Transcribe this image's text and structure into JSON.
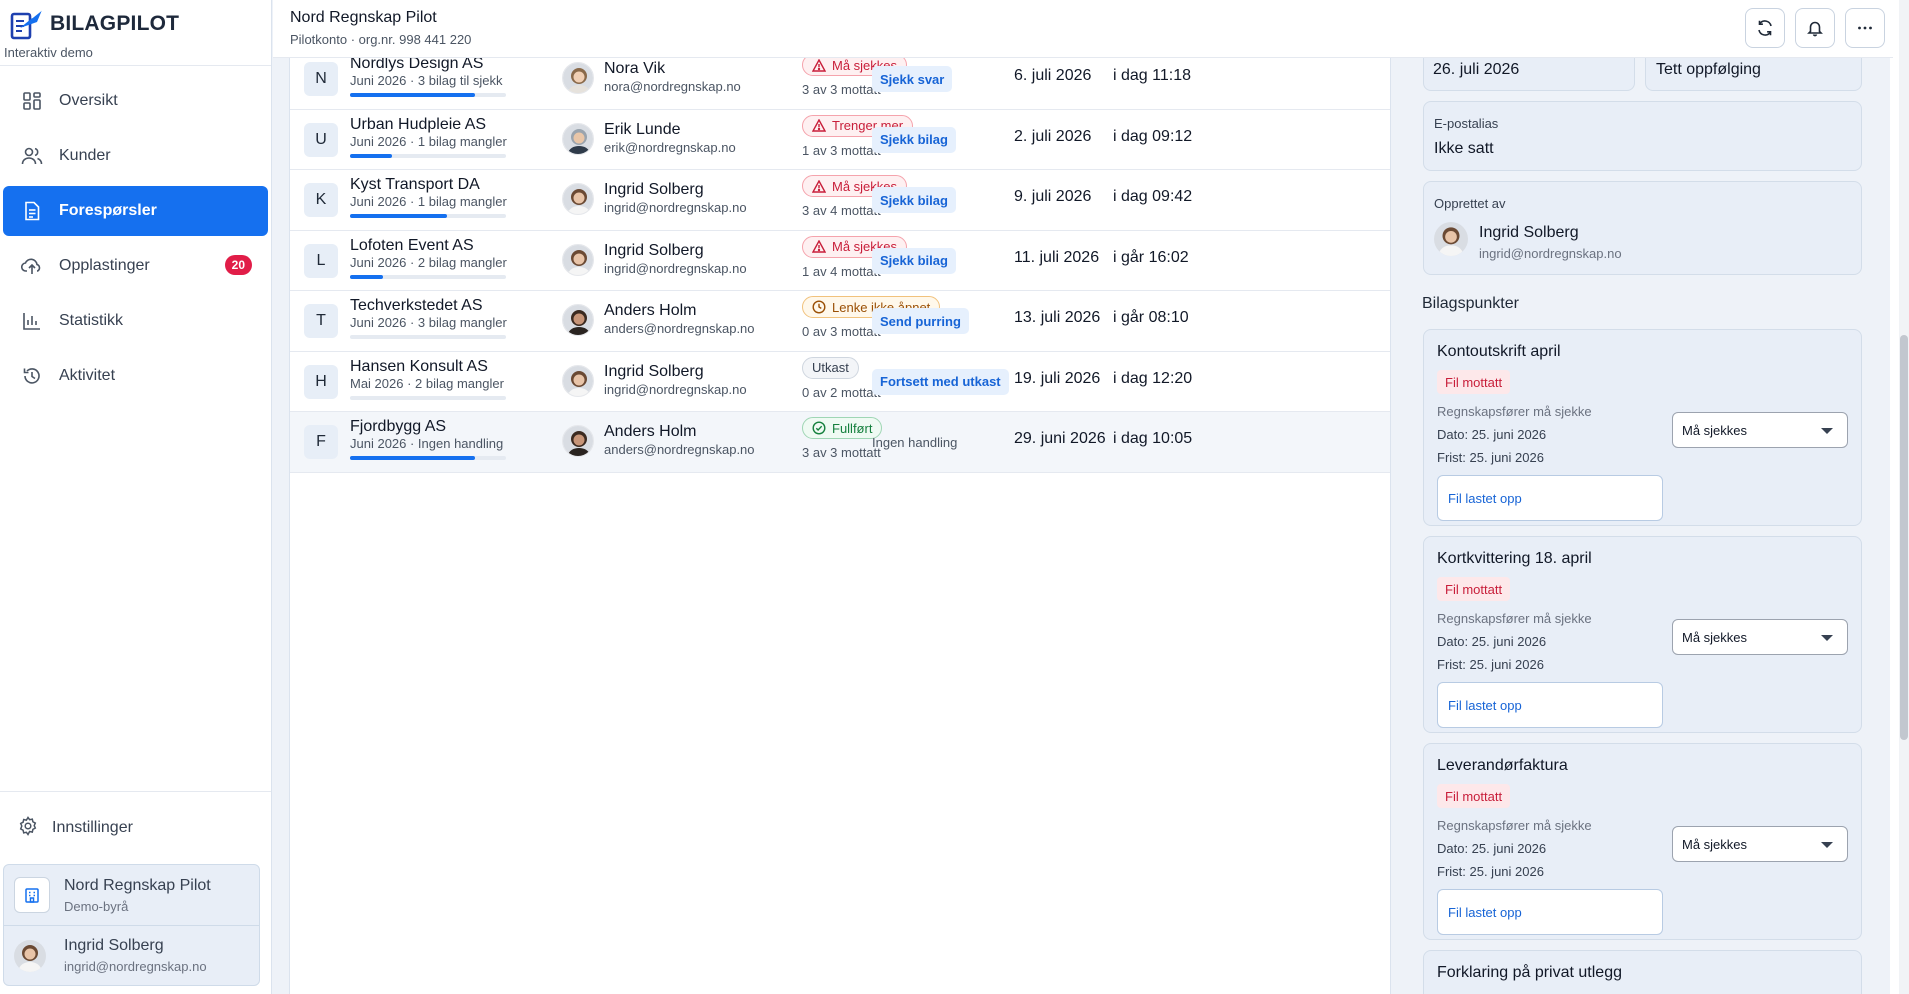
{
  "brand": {
    "name": "BILAGPILOT",
    "subtitle": "Interaktiv demo"
  },
  "nav": [
    {
      "label": "Oversikt",
      "icon": "grid-icon"
    },
    {
      "label": "Kunder",
      "icon": "users-icon"
    },
    {
      "label": "Forespørsler",
      "icon": "document-icon",
      "active": true
    },
    {
      "label": "Opplastinger",
      "icon": "upload-icon",
      "badge": "20"
    },
    {
      "label": "Statistikk",
      "icon": "bar-chart-icon"
    },
    {
      "label": "Aktivitet",
      "icon": "history-icon"
    }
  ],
  "settings_label": "Innstillinger",
  "account": {
    "org_name": "Nord Regnskap Pilot",
    "org_sub": "Demo-byrå",
    "user_name": "Ingrid Solberg",
    "user_email": "ingrid@nordregnskap.no"
  },
  "topbar": {
    "title": "Nord Regnskap Pilot",
    "subtitle": "Pilotkonto · org.nr. 998 441 220",
    "buttons": [
      "refresh-icon",
      "bell-icon",
      "more-icon"
    ]
  },
  "colors": {
    "accent": "#1570ef",
    "danger": "#c81e3a",
    "warning": "#9a4f05",
    "success": "#15803d",
    "badge": "#e11d48"
  },
  "rows": [
    {
      "initial": "N",
      "company": "Nordlys Design AS",
      "meta": "Juni 2026 · 3 bilag til sjekk",
      "progress": 0.8,
      "person": "Nora Vik",
      "email": "nora@nordregnskap.no",
      "status": "Må sjekkes",
      "status_kind": "red",
      "status_icon": "warning-icon",
      "received": "3 av 3 mottatt",
      "action": "Sjekk svar",
      "due": "6. juli 2026",
      "updated": "i dag 11:18"
    },
    {
      "initial": "U",
      "company": "Urban Hudpleie AS",
      "meta": "Juni 2026 · 1 bilag mangler",
      "progress": 0.27,
      "person": "Erik Lunde",
      "email": "erik@nordregnskap.no",
      "status": "Trenger mer",
      "status_kind": "red",
      "status_icon": "warning-icon",
      "received": "1 av 3 mottatt",
      "action": "Sjekk bilag",
      "due": "2. juli 2026",
      "updated": "i dag 09:12"
    },
    {
      "initial": "K",
      "company": "Kyst Transport DA",
      "meta": "Juni 2026 · 1 bilag mangler",
      "progress": 0.62,
      "person": "Ingrid Solberg",
      "email": "ingrid@nordregnskap.no",
      "status": "Må sjekkes",
      "status_kind": "red",
      "status_icon": "warning-icon",
      "received": "3 av 4 mottatt",
      "action": "Sjekk bilag",
      "due": "9. juli 2026",
      "updated": "i dag 09:42"
    },
    {
      "initial": "L",
      "company": "Lofoten Event AS",
      "meta": "Juni 2026 · 2 bilag mangler",
      "progress": 0.21,
      "person": "Ingrid Solberg",
      "email": "ingrid@nordregnskap.no",
      "status": "Må sjekkes",
      "status_kind": "red",
      "status_icon": "warning-icon",
      "received": "1 av 4 mottatt",
      "action": "Sjekk bilag",
      "due": "11. juli 2026",
      "updated": "i går 16:02"
    },
    {
      "initial": "T",
      "company": "Techverkstedet AS",
      "meta": "Juni 2026 · 3 bilag mangler",
      "progress": 0,
      "person": "Anders Holm",
      "email": "anders@nordregnskap.no",
      "status": "Lenke ikke åpnet",
      "status_kind": "amber",
      "status_icon": "clock-icon",
      "received": "0 av 3 mottatt",
      "action": "Send purring",
      "due": "13. juli 2026",
      "updated": "i går 08:10"
    },
    {
      "initial": "H",
      "company": "Hansen Konsult AS",
      "meta": "Mai 2026 · 2 bilag mangler",
      "progress": 0,
      "person": "Ingrid Solberg",
      "email": "ingrid@nordregnskap.no",
      "status": "Utkast",
      "status_kind": "grey",
      "status_icon": "",
      "received": "0 av 2 mottatt",
      "action": "Fortsett med utkast",
      "due": "19. juli 2026",
      "updated": "i dag 12:20"
    },
    {
      "initial": "F",
      "company": "Fjordbygg AS",
      "meta": "Juni 2026 · Ingen handling",
      "progress": 0.8,
      "person": "Anders Holm",
      "email": "anders@nordregnskap.no",
      "status": "Fullført",
      "status_kind": "green",
      "status_icon": "check-circle-icon",
      "received": "3 av 3 mottatt",
      "action": "Ingen handling",
      "action_plain": true,
      "due": "29. juni 2026",
      "updated": "i dag 10:05"
    }
  ],
  "details": {
    "deadline_value": "26. juli 2026",
    "follow_up_value": "Tett oppfølging",
    "email_alias_label": "E-postalias",
    "email_alias_value": "Ikke satt",
    "created_by_label": "Opprettet av",
    "created_by_name": "Ingrid Solberg",
    "created_by_email": "ingrid@nordregnskap.no",
    "points_heading": "Bilagspunkter"
  },
  "points": [
    {
      "title": "Kontoutskrift april",
      "badge": "Fil mottatt",
      "note": "Regnskapsfører må sjekke",
      "date": "Dato: 25. juni 2026",
      "deadline": "Frist: 25. juni 2026",
      "select": "Må sjekkes",
      "file": "Fil lastet opp"
    },
    {
      "title": "Kortkvittering 18. april",
      "badge": "Fil mottatt",
      "note": "Regnskapsfører må sjekke",
      "date": "Dato: 25. juni 2026",
      "deadline": "Frist: 25. juni 2026",
      "select": "Må sjekkes",
      "file": "Fil lastet opp"
    },
    {
      "title": "Leverandørfaktura",
      "badge": "Fil mottatt",
      "note": "Regnskapsfører må sjekke",
      "date": "Dato: 25. juni 2026",
      "deadline": "Frist: 25. juni 2026",
      "select": "Må sjekkes",
      "file": "Fil lastet opp"
    },
    {
      "title": "Forklaring på privat utlegg"
    }
  ]
}
